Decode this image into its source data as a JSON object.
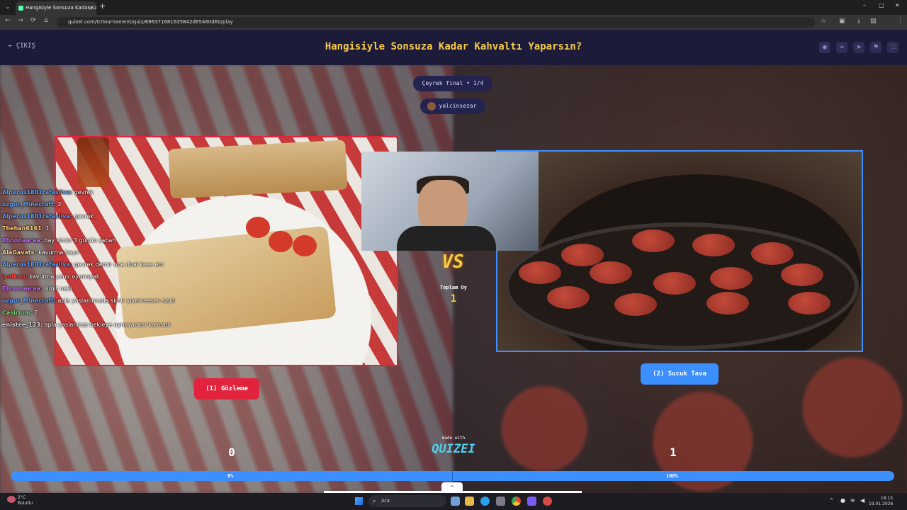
{
  "browser": {
    "tab_title": "Hangisiyle Sonsuza Kadar Kahv",
    "tab_close": "×",
    "new_tab": "+",
    "url": "quizei.com/tr/tournament/quiz/6963716816358​42d65460d60/play",
    "profile_initial": "Y",
    "window_controls": [
      "–",
      "▢",
      "✕"
    ]
  },
  "header": {
    "exit_label": "← ÇIKIŞ",
    "title": "Hangisiyle Sonsuza Kadar Kahvaltı Yaparsın?",
    "icons": [
      "eye-icon",
      "link-icon",
      "share-icon",
      "flag-icon",
      "fullscreen-icon"
    ]
  },
  "round": {
    "label": "Çeyrek final • 1/4",
    "creator": "yalcinsezar"
  },
  "left_option": {
    "button_label": "(1) Gözleme",
    "score": "0",
    "percent": "0%",
    "color": "#e2233d"
  },
  "right_option": {
    "button_label": "(2) Sucuk Tava",
    "score": "1",
    "percent": "100%",
    "color": "#3b8fff"
  },
  "center": {
    "vs": "VS",
    "total_label": "Toplam Oy",
    "total_value": "1",
    "made_with": "made with",
    "brand": "QUIZEI"
  },
  "progress": {
    "left_fraction": 0.0,
    "right_fraction": 1.0
  },
  "chat": [
    {
      "user": "Alperus1881rafasilva:",
      "msg": "gevrek",
      "color": "#5aa0ff"
    },
    {
      "user": "ozgur_Minecraft:",
      "msg": "2",
      "color": "#5aa0ff"
    },
    {
      "user": "Alperus1881rafasilva:",
      "msg": "gevrek",
      "color": "#5aa0ff"
    },
    {
      "user": "Thehan6161:",
      "msg": "1",
      "color": "#ffd27a"
    },
    {
      "user": "Ebonnaaraa:",
      "msg": "bay simin 3 günün sabah",
      "color": "#c86aff"
    },
    {
      "user": "AlaGavats:",
      "msg": "kavurma bayır",
      "color": "#ffd27a"
    },
    {
      "user": "Alperus1881rafasilva:",
      "msg": "gevrek demir ona dnal kese em",
      "color": "#5aa0ff"
    },
    {
      "user": "jvalkan:",
      "msg": "kavurma yenir oyunoyak",
      "color": "#ff4a4a"
    },
    {
      "user": "Ebonnaaraa:",
      "msg": "simit neki",
      "color": "#c86aff"
    },
    {
      "user": "ozgur_Minecraft:",
      "msg": "apla yaslanincada simir yiyemessen sjsjd",
      "color": "#5aa0ff"
    },
    {
      "user": "Casirium:",
      "msg": "2",
      "color": "#7ae07a"
    },
    {
      "user": "enistee_123:",
      "msg": "apla yaslanicaz bekleye oynayacam kalmadı",
      "color": "#dddddd"
    }
  ],
  "taskbar": {
    "weather_temp": "2°C",
    "weather_desc": "Bulutlu",
    "search_placeholder": "Ara",
    "time": "18:13",
    "date": "19.01.2026"
  }
}
